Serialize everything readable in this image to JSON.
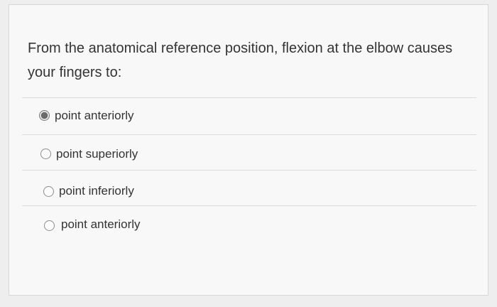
{
  "question": {
    "text": "From the anatomical reference position, flexion at the elbow causes your fingers to:"
  },
  "options": [
    {
      "label": "point anteriorly",
      "selected": true
    },
    {
      "label": "point superiorly",
      "selected": false
    },
    {
      "label": "point inferiorly",
      "selected": false
    },
    {
      "label": "point anteriorly",
      "selected": false
    }
  ]
}
